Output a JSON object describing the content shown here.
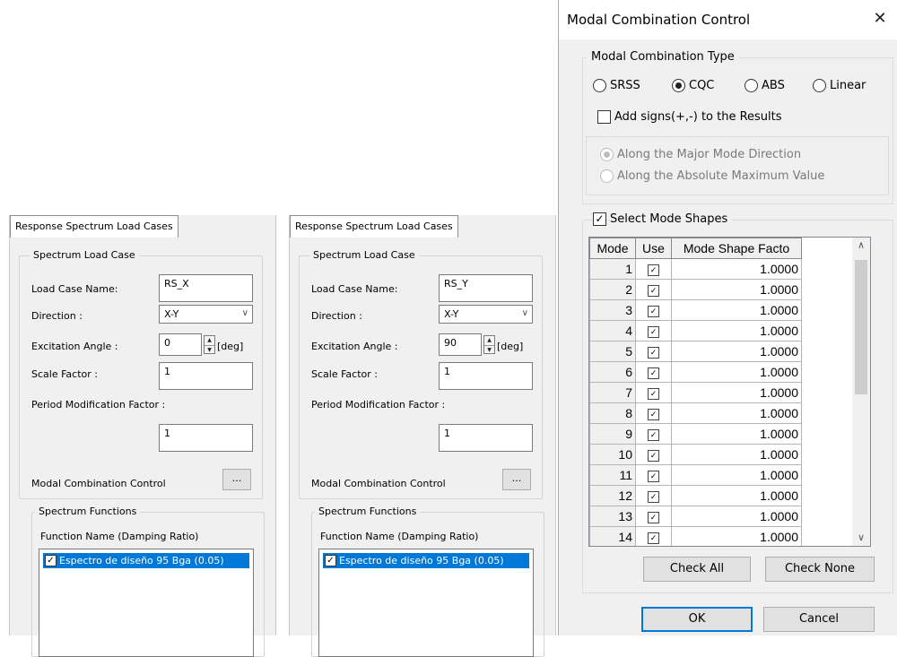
{
  "rs_panels": [
    {
      "tab_title": "Response Spectrum Load Cases",
      "group_spectrum_load_case": "Spectrum Load Case",
      "load_case_name_label": "Load Case Name:",
      "load_case_name_value": "RS_X",
      "direction_label": "Direction :",
      "direction_value": "X-Y",
      "excitation_angle_label": "Excitation Angle :",
      "excitation_angle_value": "0",
      "excitation_angle_unit": "[deg]",
      "scale_factor_label": "Scale Factor :",
      "scale_factor_value": "1",
      "period_mod_label": "Period Modification Factor :",
      "period_mod_value": "1",
      "modal_combination_label": "Modal Combination Control",
      "ellipsis_label": "...",
      "group_spectrum_functions": "Spectrum Functions",
      "function_name_header": "Function Name (Damping Ratio)",
      "function_item": "Espectro de diseño 95 Bga (0.05)"
    },
    {
      "tab_title": "Response Spectrum Load Cases",
      "group_spectrum_load_case": "Spectrum Load Case",
      "load_case_name_label": "Load Case Name:",
      "load_case_name_value": "RS_Y",
      "direction_label": "Direction :",
      "direction_value": "X-Y",
      "excitation_angle_label": "Excitation Angle :",
      "excitation_angle_value": "90",
      "excitation_angle_unit": "[deg]",
      "scale_factor_label": "Scale Factor :",
      "scale_factor_value": "1",
      "period_mod_label": "Period Modification Factor :",
      "period_mod_value": "1",
      "modal_combination_label": "Modal Combination Control",
      "ellipsis_label": "...",
      "group_spectrum_functions": "Spectrum Functions",
      "function_name_header": "Function Name (Damping Ratio)",
      "function_item": "Espectro de diseño 95 Bga (0.05)"
    }
  ],
  "dialog": {
    "title": "Modal Combination Control",
    "close_glyph": "✕",
    "combination_type_group": "Modal Combination Type",
    "types": [
      "SRSS",
      "CQC",
      "ABS",
      "Linear"
    ],
    "selected_type": "CQC",
    "add_signs_label": "Add signs(+,-) to the Results",
    "along_major": "Along the Major Mode Direction",
    "along_absolute": "Along the Absolute Maximum Value",
    "select_mode_shapes_label": "Select Mode Shapes",
    "grid_headers": [
      "Mode",
      "Use",
      "Mode Shape Facto"
    ],
    "rows": [
      {
        "mode": "1",
        "factor": "1.0000"
      },
      {
        "mode": "2",
        "factor": "1.0000"
      },
      {
        "mode": "3",
        "factor": "1.0000"
      },
      {
        "mode": "4",
        "factor": "1.0000"
      },
      {
        "mode": "5",
        "factor": "1.0000"
      },
      {
        "mode": "6",
        "factor": "1.0000"
      },
      {
        "mode": "7",
        "factor": "1.0000"
      },
      {
        "mode": "8",
        "factor": "1.0000"
      },
      {
        "mode": "9",
        "factor": "1.0000"
      },
      {
        "mode": "10",
        "factor": "1.0000"
      },
      {
        "mode": "11",
        "factor": "1.0000"
      },
      {
        "mode": "12",
        "factor": "1.0000"
      },
      {
        "mode": "13",
        "factor": "1.0000"
      },
      {
        "mode": "14",
        "factor": "1.0000"
      }
    ],
    "check_all_label": "Check All",
    "check_none_label": "Check None",
    "ok_label": "OK",
    "cancel_label": "Cancel"
  }
}
